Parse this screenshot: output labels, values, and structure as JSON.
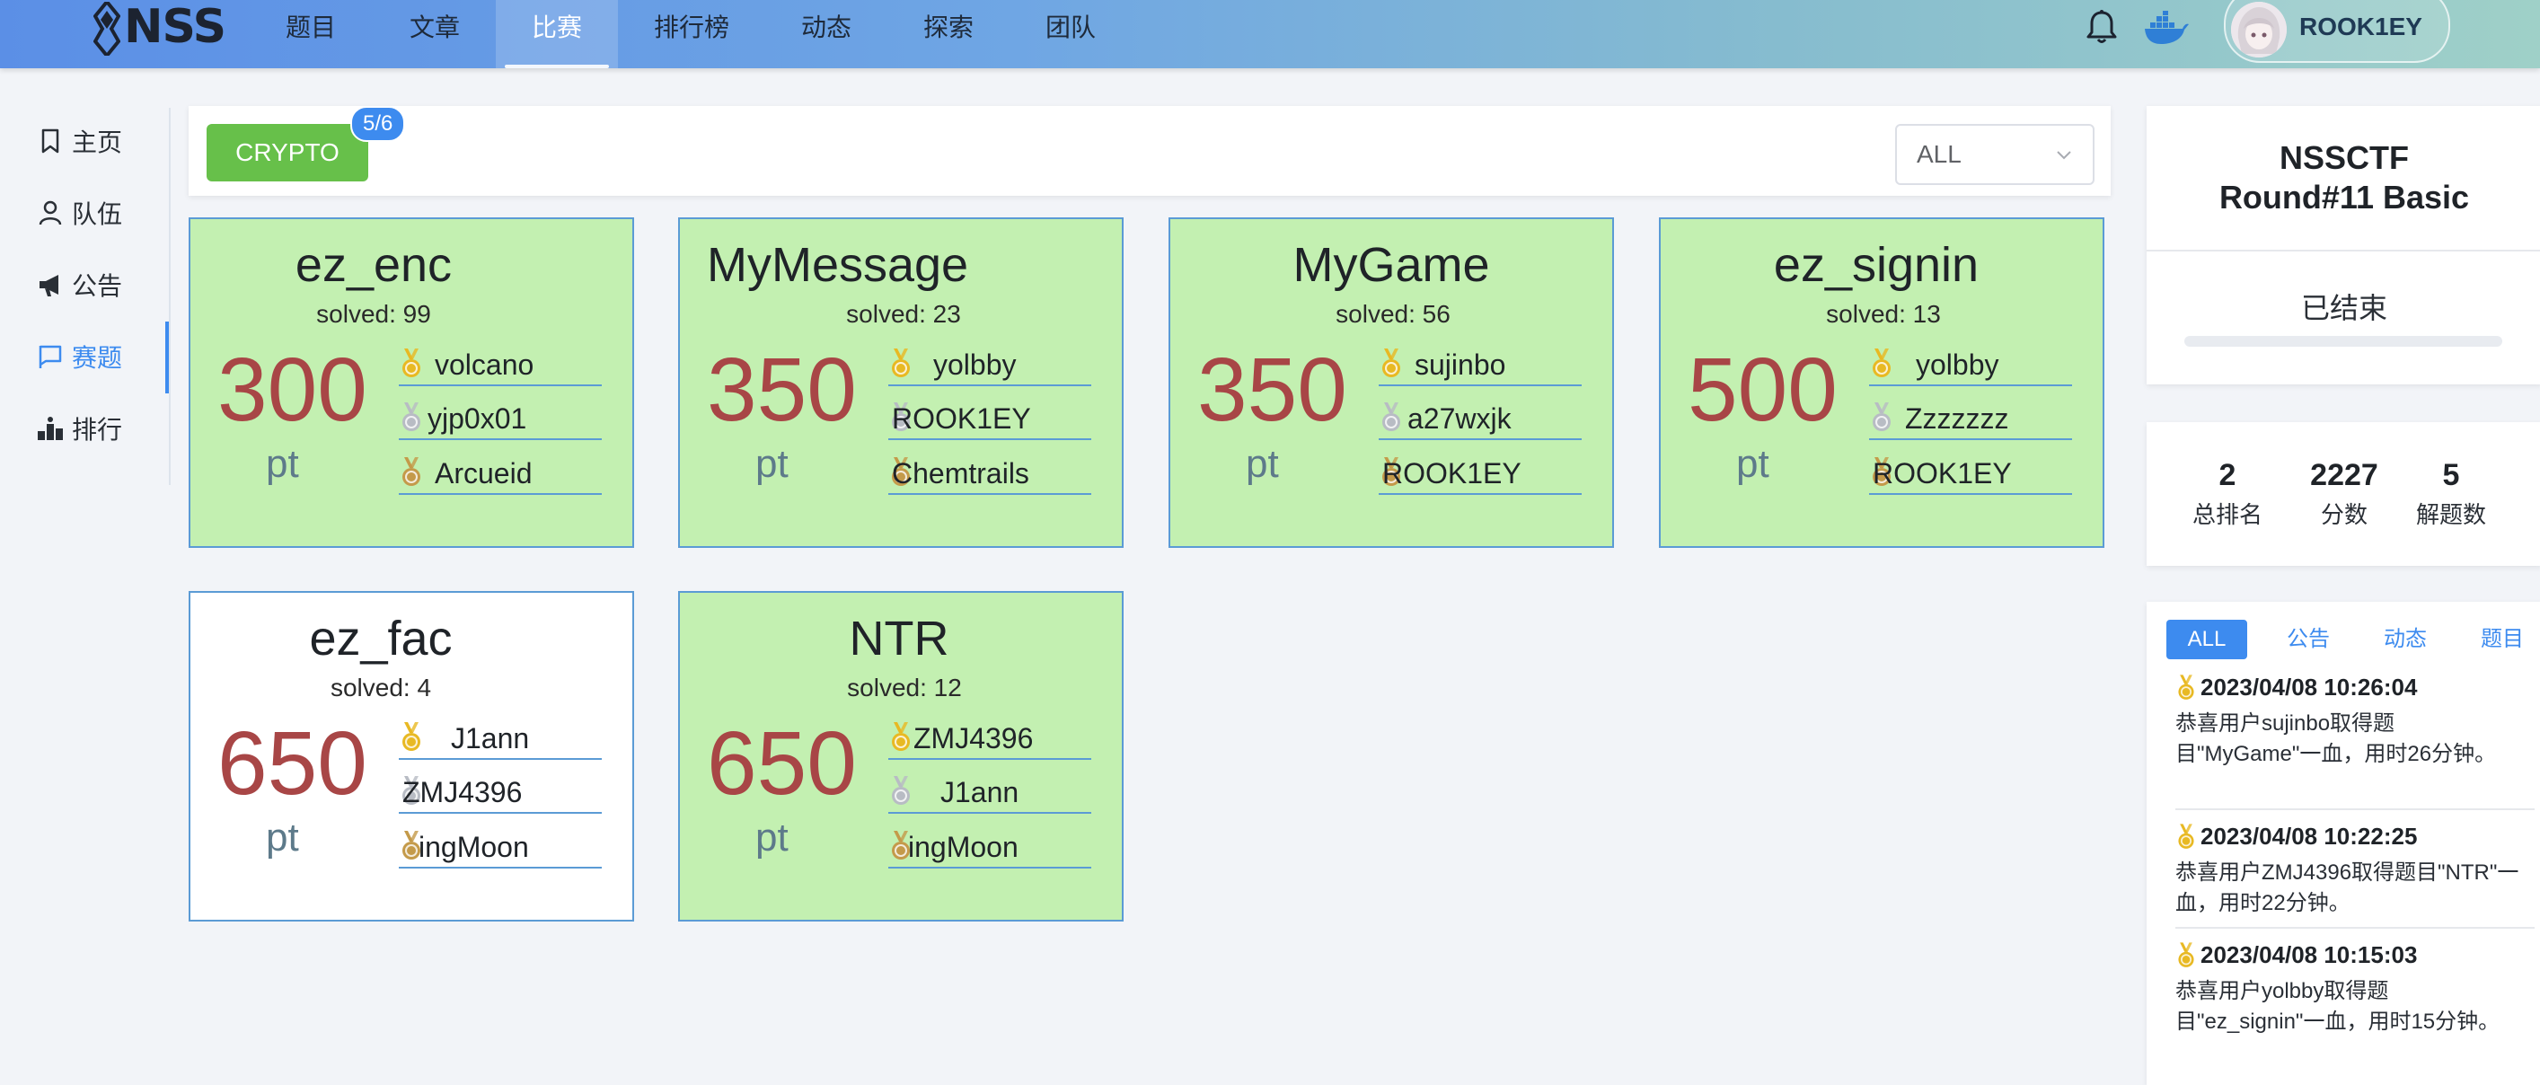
{
  "nav": {
    "logo_text": "NSS",
    "items": [
      "题目",
      "文章",
      "比赛",
      "排行榜",
      "动态",
      "探索",
      "团队"
    ],
    "active_index": 2,
    "username": "ROOK1EY"
  },
  "sidebar": {
    "items": [
      {
        "label": "主页",
        "icon": "bookmark-icon"
      },
      {
        "label": "队伍",
        "icon": "user-icon"
      },
      {
        "label": "公告",
        "icon": "megaphone-icon"
      },
      {
        "label": "赛题",
        "icon": "flag-icon"
      },
      {
        "label": "排行",
        "icon": "ranking-icon"
      }
    ],
    "active_index": 3
  },
  "filter": {
    "category": "CRYPTO",
    "count": "5/6",
    "select_value": "ALL"
  },
  "challenges": [
    {
      "title": "ez_enc",
      "solved": "solved: 99",
      "points": "300",
      "unit": "pt",
      "bloods": [
        "volcano",
        "yjp0x01",
        "Arcueid"
      ],
      "solved_by_me": true
    },
    {
      "title": "MyMessage",
      "solved": "solved: 23",
      "points": "350",
      "unit": "pt",
      "bloods": [
        "yolbby",
        "ROOK1EY",
        "Chemtrails"
      ],
      "solved_by_me": true
    },
    {
      "title": "MyGame",
      "solved": "solved: 56",
      "points": "350",
      "unit": "pt",
      "bloods": [
        "sujinbo",
        "a27wxjk",
        "ROOK1EY"
      ],
      "solved_by_me": true
    },
    {
      "title": "ez_signin",
      "solved": "solved: 13",
      "points": "500",
      "unit": "pt",
      "bloods": [
        "yolbby",
        "Zzzzzzz",
        "ROOK1EY"
      ],
      "solved_by_me": true
    },
    {
      "title": "ez_fac",
      "solved": "solved: 4",
      "points": "650",
      "unit": "pt",
      "bloods": [
        "J1ann",
        "ZMJ4396",
        "ingMoon"
      ],
      "solved_by_me": false
    },
    {
      "title": "NTR",
      "solved": "solved: 12",
      "points": "650",
      "unit": "pt",
      "bloods": [
        "ZMJ4396",
        "J1ann",
        "ingMoon"
      ],
      "solved_by_me": true
    }
  ],
  "contest": {
    "title_line1": "NSSCTF",
    "title_line2": "Round#11 Basic",
    "status": "已结束"
  },
  "stats": [
    {
      "value": "2",
      "label": "总排名"
    },
    {
      "value": "2227",
      "label": "分数"
    },
    {
      "value": "5",
      "label": "解题数"
    }
  ],
  "feed": {
    "tabs": [
      "ALL",
      "公告",
      "动态",
      "题目"
    ],
    "active_tab": 0,
    "items": [
      {
        "time": "2023/04/08 10:26:04",
        "text": "恭喜用户sujinbo取得题目\"MyGame\"一血，用时26分钟。"
      },
      {
        "time": "2023/04/08 10:22:25",
        "text": "恭喜用户ZMJ4396取得题目\"NTR\"一血，用时22分钟。"
      },
      {
        "time": "2023/04/08 10:15:03",
        "text": "恭喜用户yolbby取得题目\"ez_signin\"一血，用时15分钟。"
      }
    ]
  },
  "colors": {
    "accent": "#3d8bef",
    "solved_card": "#c3f0b1",
    "points": "#a84646",
    "category_button": "#67c04a",
    "gold": "#e8b923",
    "silver": "#b8bcc4",
    "bronze": "#c49a4a"
  }
}
